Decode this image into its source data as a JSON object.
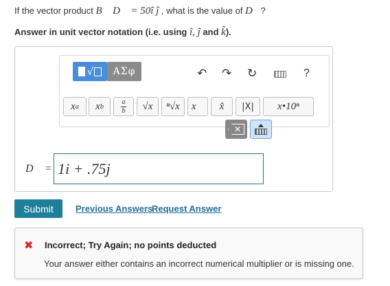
{
  "question": {
    "line1_prefix": "If the vector product ",
    "line1_expr": "B⃗ D⃗ = 50î ĵ",
    "line1_mid": " , what is the value of ",
    "line1_var": "D⃗",
    "line1_end": "?",
    "line2_prefix": "Answer in unit vector notation (i.e. using ",
    "line2_units": "î, ĵ",
    "line2_and": " and ",
    "line2_k": "k̂",
    "line2_end": ")."
  },
  "toolbar": {
    "mode_greek_label": "ΑΣφ",
    "undo_icon": "↶",
    "redo_icon": "↷",
    "reset_icon": "↻",
    "help_label": "?",
    "buttons": {
      "superscript_base": "x",
      "superscript_exp": "a",
      "subscript_base": "x",
      "subscript_sub": "b",
      "fraction_num": "a",
      "fraction_den": "b",
      "sqrt": "√x",
      "nthroot": "ⁿ√x",
      "vector": "x⃗",
      "unit_vector": "x̂",
      "abs": "|X|",
      "sci_notation": "x•10ⁿ"
    }
  },
  "answer": {
    "variable_label": "D⃗ =",
    "value": "1i + .75j"
  },
  "actions": {
    "submit_label": "Submit",
    "previous_answers_label": "Previous Answers",
    "request_answer_label": "Request Answer"
  },
  "feedback": {
    "status_icon": "✖",
    "title": "Incorrect; Try Again; no points deducted",
    "message": "Your answer either contains an incorrect numerical multiplier or is missing one."
  },
  "colors": {
    "submit": "#1f7f9a",
    "link": "#236f99",
    "error": "#d6241a",
    "input_border": "#2b6f8f",
    "template_mode": "#4a8ed9"
  }
}
